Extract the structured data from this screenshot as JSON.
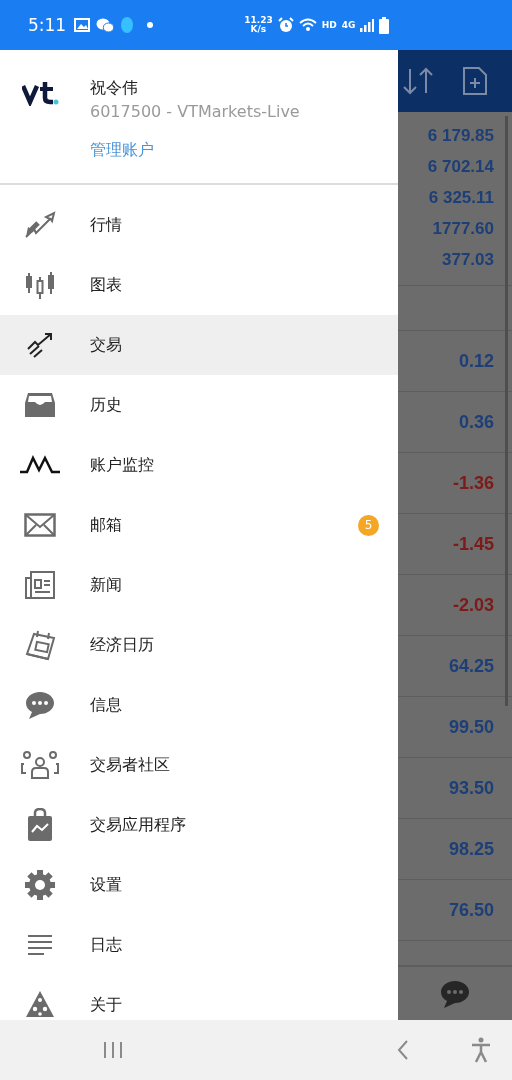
{
  "status_bar": {
    "time": "5:11",
    "net_speed": "11.23",
    "net_unit": "K/s",
    "hd": "HD",
    "network": "4G"
  },
  "drawer": {
    "account": {
      "name": "祝令伟",
      "number": "6017500 - VTMarkets-Live",
      "manage_link": "管理账户"
    },
    "items": [
      {
        "label": "行情",
        "selected": false
      },
      {
        "label": "图表",
        "selected": false
      },
      {
        "label": "交易",
        "selected": true
      },
      {
        "label": "历史",
        "selected": false
      },
      {
        "label": "账户监控",
        "selected": false
      },
      {
        "label": "邮箱",
        "selected": false,
        "badge": "5"
      },
      {
        "label": "新闻",
        "selected": false
      },
      {
        "label": "经济日历",
        "selected": false
      },
      {
        "label": "信息",
        "selected": false
      },
      {
        "label": "交易者社区",
        "selected": false
      },
      {
        "label": "交易应用程序",
        "selected": false
      },
      {
        "label": "设置",
        "selected": false
      },
      {
        "label": "日志",
        "selected": false
      },
      {
        "label": "关于",
        "selected": false
      }
    ]
  },
  "background": {
    "quotes": [
      {
        "value": "6 179.85",
        "negative": false
      },
      {
        "value": "6 702.14",
        "negative": false
      },
      {
        "value": "6 325.11",
        "negative": false
      },
      {
        "value": "1777.60",
        "negative": false
      },
      {
        "value": "377.03",
        "negative": false
      }
    ],
    "positions": [
      {
        "value": "0.12",
        "negative": false
      },
      {
        "value": "0.36",
        "negative": false
      },
      {
        "value": "-1.36",
        "negative": true
      },
      {
        "value": "-1.45",
        "negative": true
      },
      {
        "value": "-2.03",
        "negative": true
      },
      {
        "value": "64.25",
        "negative": false
      },
      {
        "value": "99.50",
        "negative": false
      },
      {
        "value": "93.50",
        "negative": false
      },
      {
        "value": "98.25",
        "negative": false
      },
      {
        "value": "76.50",
        "negative": false
      }
    ]
  }
}
